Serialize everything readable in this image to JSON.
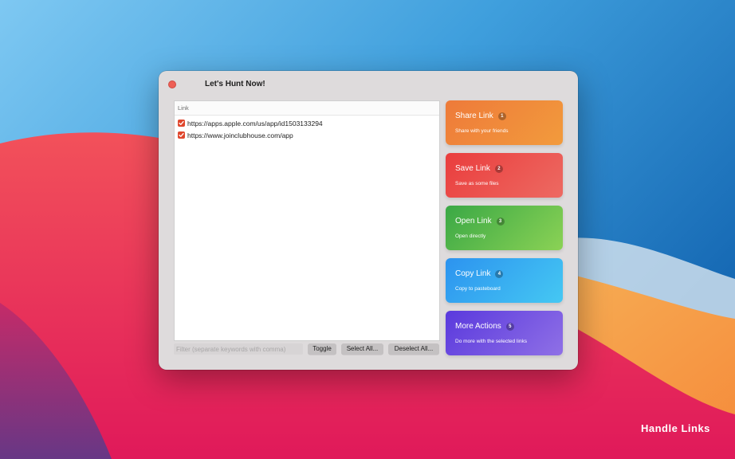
{
  "window": {
    "title": "Let's Hunt Now!"
  },
  "table": {
    "column_header": "Link",
    "rows": [
      {
        "checked": true,
        "url": "https://apps.apple.com/us/app/id1503133294"
      },
      {
        "checked": true,
        "url": "https://www.joinclubhouse.com/app"
      }
    ]
  },
  "toolbar": {
    "filter_placeholder": "Filter (separate keywords with comma)",
    "filter_value": "",
    "toggle_label": "Toggle",
    "select_all_label": "Select All...",
    "deselect_all_label": "Deselect All..."
  },
  "actions": [
    {
      "title": "Share Link",
      "badge": "1",
      "subtitle": "Share with your friends",
      "color": "#ee7a3a"
    },
    {
      "title": "Save Link",
      "badge": "2",
      "subtitle": "Save as some files",
      "color": "#ea3d3d"
    },
    {
      "title": "Open Link",
      "badge": "3",
      "subtitle": "Open directly",
      "color": "#3aa845"
    },
    {
      "title": "Copy Link",
      "badge": "4",
      "subtitle": "Copy to pasteboard",
      "color": "#2c93ef"
    },
    {
      "title": "More Actions",
      "badge": "5",
      "subtitle": "Do more with the selected links",
      "color": "#5a39dd"
    }
  ],
  "branding": {
    "text": "Handle Links"
  },
  "icons": {
    "close": "close-icon",
    "checkbox": "checkmark-icon"
  }
}
